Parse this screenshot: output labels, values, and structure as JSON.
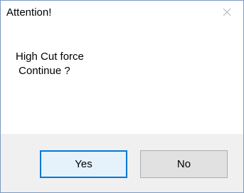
{
  "dialog": {
    "title": "Attention!",
    "close_icon": "close-icon",
    "message_lines": [
      "High Cut force",
      " Continue ?"
    ],
    "buttons": {
      "yes_label": "Yes",
      "no_label": "No"
    },
    "colors": {
      "accent": "#0078d7",
      "footer_bg": "#f0f0f0",
      "button_bg": "#e1e1e1"
    }
  }
}
